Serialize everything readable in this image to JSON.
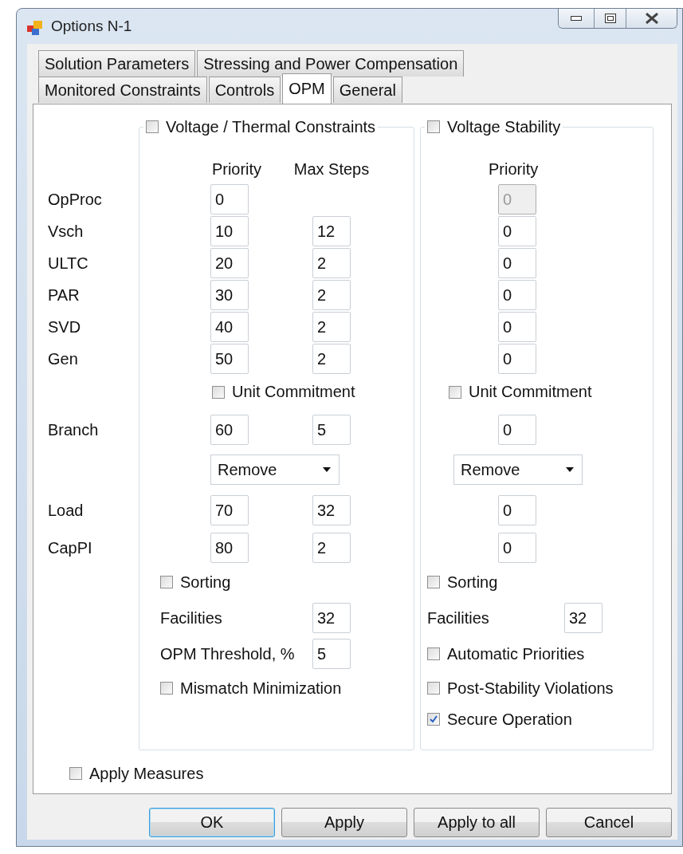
{
  "window": {
    "title": "Options N-1"
  },
  "tab_rows": [
    {
      "tabs": [
        {
          "label": "Solution Parameters",
          "selected": false
        },
        {
          "label": "Stressing and Power Compensation",
          "selected": false
        }
      ]
    },
    {
      "tabs": [
        {
          "label": "Monitored Constraints",
          "selected": false
        },
        {
          "label": "Controls",
          "selected": false
        },
        {
          "label": "OPM",
          "selected": true
        },
        {
          "label": "General",
          "selected": false
        }
      ]
    }
  ],
  "groups": [
    {
      "title": "Voltage / Thermal Constraints",
      "checked": false
    },
    {
      "title": "Voltage Stability",
      "checked": false
    }
  ],
  "column_headers": [
    "Priority",
    "Max Steps",
    "Priority"
  ],
  "rows": [
    {
      "kind": "fields",
      "label": "OpProc",
      "priority": {
        "value": "0",
        "disabled": false
      },
      "right_priority": {
        "value": "0",
        "disabled": true
      }
    },
    {
      "kind": "fields",
      "label": "Vsch",
      "priority": {
        "value": "10",
        "disabled": false
      },
      "max_steps": {
        "value": "12",
        "disabled": false
      },
      "right_priority": {
        "value": "0",
        "disabled": false
      }
    },
    {
      "kind": "fields",
      "label": "ULTC",
      "priority": {
        "value": "20",
        "disabled": false
      },
      "max_steps": {
        "value": "2",
        "disabled": false
      },
      "right_priority": {
        "value": "0",
        "disabled": false
      }
    },
    {
      "kind": "fields",
      "label": "PAR",
      "priority": {
        "value": "30",
        "disabled": false
      },
      "max_steps": {
        "value": "2",
        "disabled": false
      },
      "right_priority": {
        "value": "0",
        "disabled": false
      }
    },
    {
      "kind": "fields",
      "label": "SVD",
      "priority": {
        "value": "40",
        "disabled": false
      },
      "max_steps": {
        "value": "2",
        "disabled": false
      },
      "right_priority": {
        "value": "0",
        "disabled": false
      }
    },
    {
      "kind": "fields",
      "label": "Gen",
      "priority": {
        "value": "50",
        "disabled": false
      },
      "max_steps": {
        "value": "2",
        "disabled": false
      },
      "right_priority": {
        "value": "0",
        "disabled": false
      }
    },
    {
      "kind": "checkboxes",
      "left": {
        "label": "Unit Commitment",
        "checked": false
      },
      "right": {
        "label": "Unit Commitment",
        "checked": false
      }
    },
    {
      "kind": "fields",
      "label": "Branch",
      "priority": {
        "value": "60",
        "disabled": false
      },
      "max_steps": {
        "value": "5",
        "disabled": false
      },
      "right_priority": {
        "value": "0",
        "disabled": false
      }
    },
    {
      "kind": "dropdowns",
      "left": {
        "value": "Remove"
      },
      "right": {
        "value": "Remove"
      }
    },
    {
      "kind": "fields",
      "label": "Load",
      "priority": {
        "value": "70",
        "disabled": false
      },
      "max_steps": {
        "value": "32",
        "disabled": false
      },
      "right_priority": {
        "value": "0",
        "disabled": false
      }
    },
    {
      "kind": "fields",
      "label": "CapPI",
      "priority": {
        "value": "80",
        "disabled": false
      },
      "max_steps": {
        "value": "2",
        "disabled": false
      },
      "right_priority": {
        "value": "0",
        "disabled": false
      }
    }
  ],
  "bottom_rows": [
    {
      "left": {
        "kind": "checkbox",
        "label": "Sorting",
        "checked": false
      },
      "right": {
        "kind": "checkbox",
        "label": "Sorting",
        "checked": false
      }
    },
    {
      "left": {
        "kind": "field",
        "label": "Facilities",
        "value": "32"
      },
      "right": {
        "kind": "field",
        "label": "Facilities",
        "value": "32"
      }
    },
    {
      "left": {
        "kind": "field",
        "label": "OPM Threshold, %",
        "value": "5"
      },
      "right": {
        "kind": "checkbox",
        "label": "Automatic Priorities",
        "checked": false
      }
    },
    {
      "left": {
        "kind": "checkbox",
        "label": "Mismatch Minimization",
        "checked": false
      },
      "right": {
        "kind": "checkbox",
        "label": "Post-Stability Violations",
        "checked": false
      }
    },
    {
      "right": {
        "kind": "checkbox",
        "label": "Secure Operation",
        "checked": true
      }
    }
  ],
  "apply_measures": {
    "label": "Apply Measures",
    "checked": false
  },
  "buttons": [
    {
      "label": "OK",
      "default": true
    },
    {
      "label": "Apply",
      "default": false
    },
    {
      "label": "Apply to all",
      "default": false
    },
    {
      "label": "Cancel",
      "default": false
    }
  ]
}
